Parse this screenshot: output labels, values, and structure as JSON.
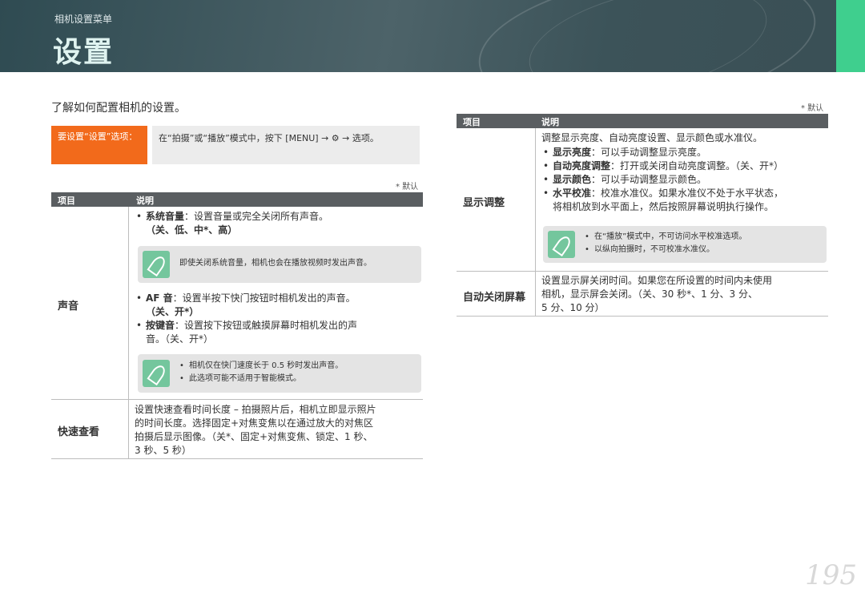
{
  "header": {
    "subtitle": "相机设置菜单",
    "title": "设置"
  },
  "intro": "了解如何配置相机的设置。",
  "howto": {
    "label": "要设置“设置”选项：",
    "instruction": "在“拍摄”或“播放”模式中，按下 [MENU] → ⚙ → 选项。"
  },
  "default_mark": "* 默认",
  "table_headers": {
    "item": "项目",
    "desc": "说明"
  },
  "sound": {
    "name": "声音",
    "b1_label": "系统音量",
    "b1_text": "：设置音量或完全关闭所有声音。",
    "b1_opts": "（关、低、中*、高）",
    "note1": "即使关闭系统音量，相机也会在播放视频时发出声音。",
    "b2_label": "AF 音",
    "b2_text": "：设置半按下快门按钮时相机发出的声音。",
    "b2_opts": "（关、开*）",
    "b3_label": "按键音",
    "b3_text": "：设置按下按钮或触摸屏幕时相机发出的声",
    "b3_cont": "音。（关、开*）",
    "note2_1": "相机仅在快门速度长于 0.5 秒时发出声音。",
    "note2_2": "此选项可能不适用于智能模式。"
  },
  "quickview": {
    "name": "快速查看",
    "line1": "设置快速查看时间长度 – 拍摄照片后，相机立即显示照片",
    "line2": "的时间长度。选择固定+对焦变焦以在通过放大的对焦区",
    "line3": "拍摄后显示图像。（关*、固定+对焦变焦、锁定、1 秒、",
    "line4": "3 秒、5 秒）"
  },
  "display": {
    "name": "显示调整",
    "intro": "调整显示亮度、自动亮度设置、显示颜色或水准仪。",
    "b1_label": "显示亮度",
    "b1_text": "：可以手动调整显示亮度。",
    "b2_label": "自动亮度调整",
    "b2_text": "：打开或关闭自动亮度调整。（关、开*）",
    "b3_label": "显示颜色",
    "b3_text": "：可以手动调整显示颜色。",
    "b4_label": "水平校准",
    "b4_text": "：校准水准仪。如果水准仪不处于水平状态，",
    "b4_cont": "将相机放到水平面上，然后按照屏幕说明执行操作。",
    "note1": "在“播放”模式中，不可访问水平校准选项。",
    "note2": "以纵向拍摄时，不可校准水准仪。"
  },
  "autooff": {
    "name": "自动关闭屏幕",
    "line1": "设置显示屏关闭时间。如果您在所设置的时间内未使用",
    "line2": "相机，显示屏会关闭。（关、30 秒*、1 分、3 分、",
    "line3": "5 分、10 分）"
  },
  "page_number": "195"
}
